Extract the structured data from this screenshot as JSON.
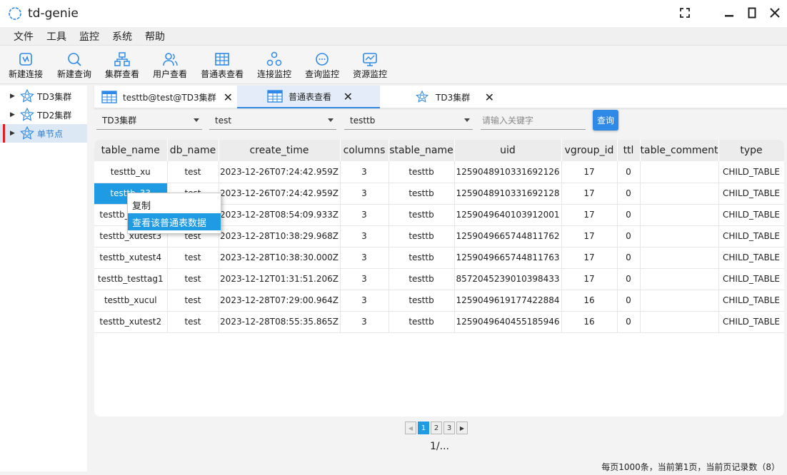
{
  "app": {
    "title": "td-genie"
  },
  "menu": [
    "文件",
    "工具",
    "监控",
    "系统",
    "帮助"
  ],
  "toolbar": [
    {
      "label": "新建连接",
      "icon": "new-connection-icon"
    },
    {
      "label": "新建查询",
      "icon": "new-query-icon"
    },
    {
      "label": "集群查看",
      "icon": "cluster-view-icon"
    },
    {
      "label": "用户查看",
      "icon": "user-view-icon"
    },
    {
      "label": "普通表查看",
      "icon": "table-view-icon"
    },
    {
      "label": "连接监控",
      "icon": "connection-monitor-icon"
    },
    {
      "label": "查询监控",
      "icon": "query-monitor-icon"
    },
    {
      "label": "资源监控",
      "icon": "resource-monitor-icon"
    }
  ],
  "tree": [
    {
      "label": "TD3集群",
      "active": false
    },
    {
      "label": "TD2集群",
      "active": false
    },
    {
      "label": "单节点",
      "active": true
    }
  ],
  "tabs": [
    {
      "label": "testtb@test@TD3集群",
      "active": false
    },
    {
      "label": "普通表查看",
      "active": true
    },
    {
      "label": "TD3集群",
      "active": false
    }
  ],
  "filters": {
    "cluster": "TD3集群",
    "database": "test",
    "stable": "testtb",
    "keyword_placeholder": "请输入关键字",
    "query_button": "查询"
  },
  "table": {
    "columns": [
      "table_name",
      "db_name",
      "create_time",
      "columns",
      "stable_name",
      "uid",
      "vgroup_id",
      "ttl",
      "table_comment",
      "type"
    ],
    "rows": [
      [
        "testtb_xu",
        "test",
        "2023-12-26T07:24:42.959Z",
        "3",
        "testtb",
        "1259048910331692126",
        "17",
        "0",
        "",
        "CHILD_TABLE"
      ],
      [
        "testtb_33",
        "test",
        "2023-12-26T07:24:42.959Z",
        "3",
        "testtb",
        "1259048910331692128",
        "17",
        "0",
        "",
        "CHILD_TABLE"
      ],
      [
        "testtb_xutest1",
        "test",
        "2023-12-28T08:54:09.933Z",
        "3",
        "testtb",
        "1259049640103912001",
        "17",
        "0",
        "",
        "CHILD_TABLE"
      ],
      [
        "testtb_xutest3",
        "test",
        "2023-12-28T10:38:29.968Z",
        "3",
        "testtb",
        "1259049665744811762",
        "17",
        "0",
        "",
        "CHILD_TABLE"
      ],
      [
        "testtb_xutest4",
        "test",
        "2023-12-28T10:38:30.000Z",
        "3",
        "testtb",
        "1259049665744811763",
        "17",
        "0",
        "",
        "CHILD_TABLE"
      ],
      [
        "testtb_testtag1",
        "test",
        "2023-12-12T01:31:51.206Z",
        "3",
        "testtb",
        "8572045239010398433",
        "17",
        "0",
        "",
        "CHILD_TABLE"
      ],
      [
        "testtb_xucul",
        "test",
        "2023-12-28T07:29:00.964Z",
        "3",
        "testtb",
        "1259049619177422884",
        "16",
        "0",
        "",
        "CHILD_TABLE"
      ],
      [
        "testtb_xutest2",
        "test",
        "2023-12-28T08:55:35.865Z",
        "3",
        "testtb",
        "1259049640455185946",
        "16",
        "0",
        "",
        "CHILD_TABLE"
      ]
    ]
  },
  "context_menu": {
    "items": [
      "复制",
      "查看该普通表数据"
    ]
  },
  "pagination": {
    "pages": [
      "1",
      "2",
      "3"
    ],
    "current": "1",
    "label": "1/..."
  },
  "status": "每页1000条，当前第1页，当前页记录数（8）",
  "colors": {
    "accent": "#2e8ae6",
    "selected": "#1e9be3",
    "active_marker": "#e02020"
  }
}
